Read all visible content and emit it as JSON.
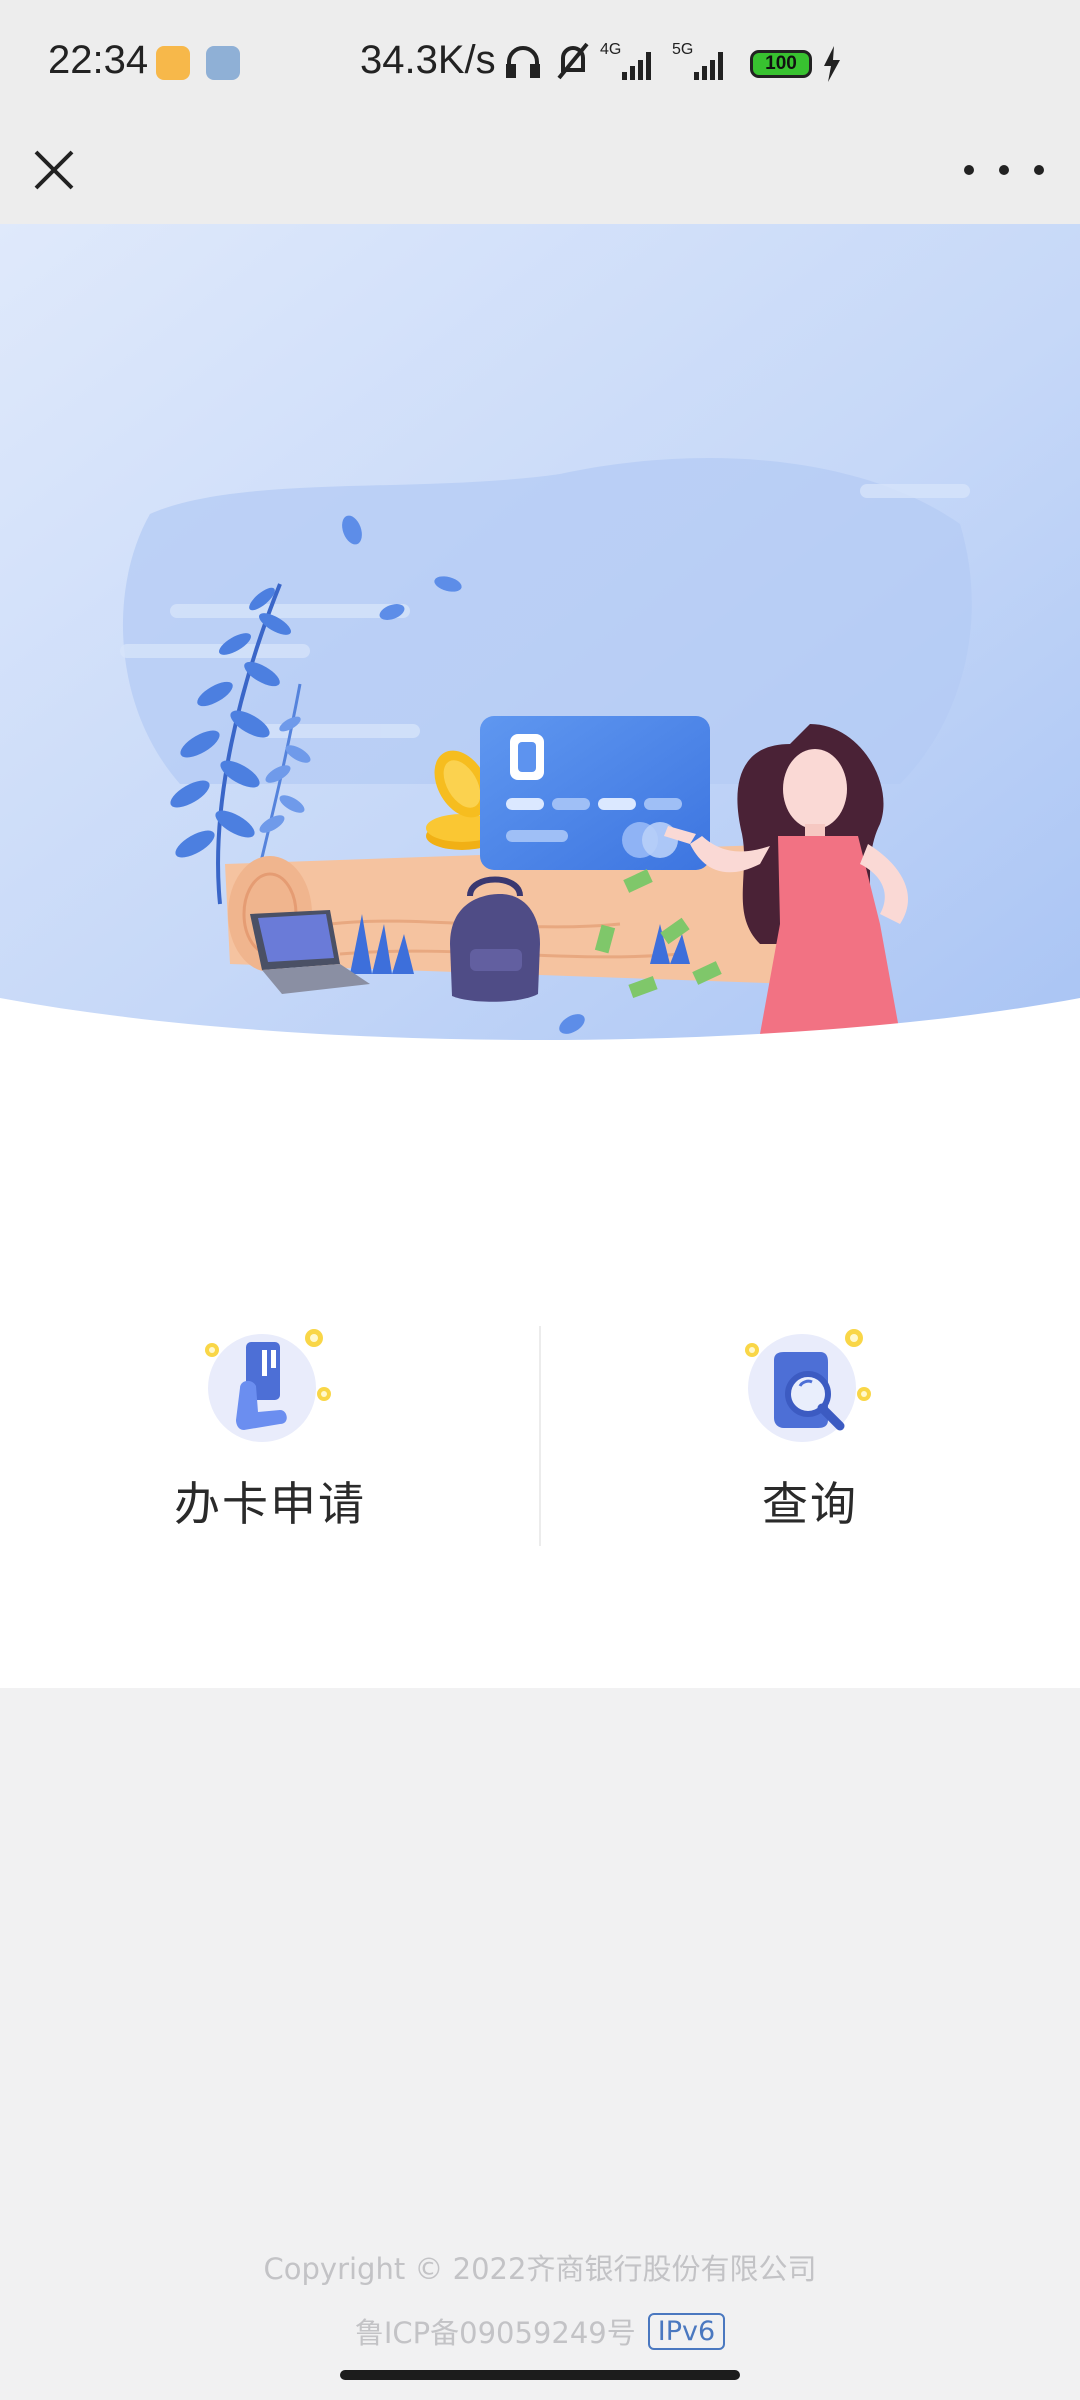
{
  "status_bar": {
    "time": "22:34",
    "net_speed": "34.3K/s",
    "signal_1": "4G",
    "signal_2": "5G",
    "battery": "100",
    "icons": [
      "headphones-icon",
      "mute-bell-icon",
      "signal-4g-icon",
      "signal-5g-icon",
      "battery-icon",
      "charging-icon"
    ]
  },
  "nav": {
    "close_icon": "close-icon",
    "more_icon": "more-icon"
  },
  "menu": {
    "items": [
      {
        "label": "办卡申请",
        "icon": "card-apply-icon"
      },
      {
        "label": "查询",
        "icon": "search-query-icon"
      }
    ]
  },
  "footer": {
    "copyright": "Copyright © 2022齐商银行股份有限公司",
    "icp": "鲁ICP备09059249号",
    "ipv6": "IPv6"
  },
  "colors": {
    "accent": "#4a7fe8",
    "hero_bg": "#b6cdf7",
    "page_bg": "#f1f1f2",
    "badge_border": "#4a78c0"
  }
}
